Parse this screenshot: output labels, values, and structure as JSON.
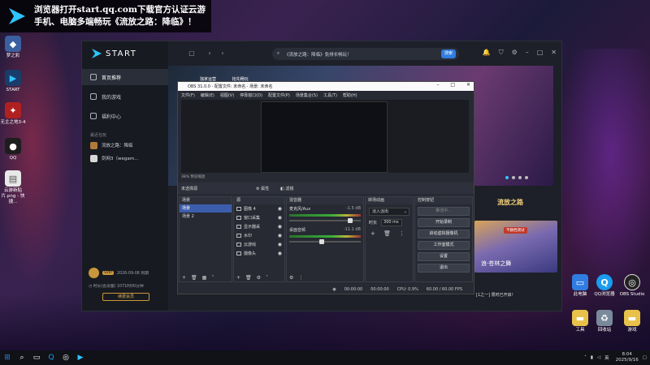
{
  "banner": {
    "line1": "浏览器打开start.qq.com下载官方认证云游",
    "line2": "手机、电脑多端畅玩《流放之路：降临》！"
  },
  "desktop_left": [
    {
      "label": "梦之彩",
      "color": "#3c5fa0",
      "icon": "game-icon"
    },
    {
      "label": "START",
      "color": "#1a3c6a",
      "icon": "start-icon"
    },
    {
      "label": "无主之地3-4",
      "color": "#b02020",
      "icon": "game-icon"
    },
    {
      "label": "QQ",
      "color": "#1d1d1d",
      "icon": "qq-icon"
    },
    {
      "label": "云游新贴片.png - 快捷...",
      "color": "#e8e8e8",
      "icon": "file-icon"
    }
  ],
  "start": {
    "brand": "START",
    "nav": [
      {
        "label": "首页推荐",
        "active": true
      },
      {
        "label": "我的游戏",
        "active": false
      },
      {
        "label": "福利中心",
        "active": false
      }
    ],
    "recent_title": "最近在玩",
    "recent": [
      {
        "label": "流放之路：降临",
        "color": "#b07a3a"
      },
      {
        "label": "剑网3（wegam...",
        "color": "#d8d8d8"
      }
    ],
    "user": {
      "vip": "SVIP",
      "expiry": "2026-09-08 到期",
      "time_label": "时长(会员服)",
      "time_value": "1071时00分钟",
      "renew": "续费会员"
    },
    "search_text": "《流放之路：降临》免排长畅玩！",
    "search_button": "搜索",
    "hero_tabs": [
      "独家运营",
      "抢先畅玩"
    ],
    "card": {
      "title": "流放之路",
      "badge": "不删档测试",
      "subtitle": "浪·苍林之舞"
    }
  },
  "obs": {
    "title": "OBS 31.0.0 - 配置文件: 未命名 - 场景: 未命名",
    "menu": [
      "文件(F)",
      "编辑(E)",
      "视图(V)",
      "停靠窗口(D)",
      "配置文件(P)",
      "场景集合(S)",
      "工具(T)",
      "帮助(H)"
    ],
    "zoom": "38%  预览缩放",
    "source_none": "未选择源",
    "props": "属性",
    "filters": "滤镜",
    "docks": {
      "scenes": "场景",
      "sources": "源",
      "mixer": "混音器",
      "transitions": "转场动画",
      "controls": "控制按钮"
    },
    "scenes": [
      {
        "label": "场景",
        "selected": true
      },
      {
        "label": "场景 2",
        "selected": false
      }
    ],
    "sources": [
      "图像 4",
      "窗口采集",
      "显示器采",
      "水印",
      "云游戏",
      "摄像头"
    ],
    "mixer": [
      {
        "name": "麦克风/Aux",
        "db": "-1.5 dB",
        "level": 0.85
      },
      {
        "name": "桌面音频",
        "db": "-11.1 dB",
        "level": 0.45
      }
    ],
    "transition": "淡入淡出",
    "duration_label": "时长",
    "duration": "300 ms",
    "controls": [
      "推流中...",
      "开始录制",
      "启动虚拟摄像机",
      "工作室模式",
      "设置",
      "退出"
    ],
    "status": {
      "t1": "00:00:00",
      "t2": "00:00:00",
      "cpu": "CPU: 0.9%",
      "fps": "60.00 / 60.00 FPS"
    }
  },
  "desktop_right": [
    {
      "label": "此电脑",
      "icon": "computer-icon"
    },
    {
      "label": "QQ浏览器",
      "icon": "browser-icon"
    },
    {
      "label": "OBS Studio",
      "icon": "obs-icon"
    },
    {
      "label": "工具",
      "icon": "folder-icon"
    },
    {
      "label": "回收站",
      "icon": "recycle-icon"
    },
    {
      "label": "游戏",
      "icon": "folder-icon"
    }
  ],
  "notice": "[1之一] 限时已开启！",
  "taskbar": {
    "lang": "英",
    "time": "8:04",
    "date": "2025/9/16"
  }
}
